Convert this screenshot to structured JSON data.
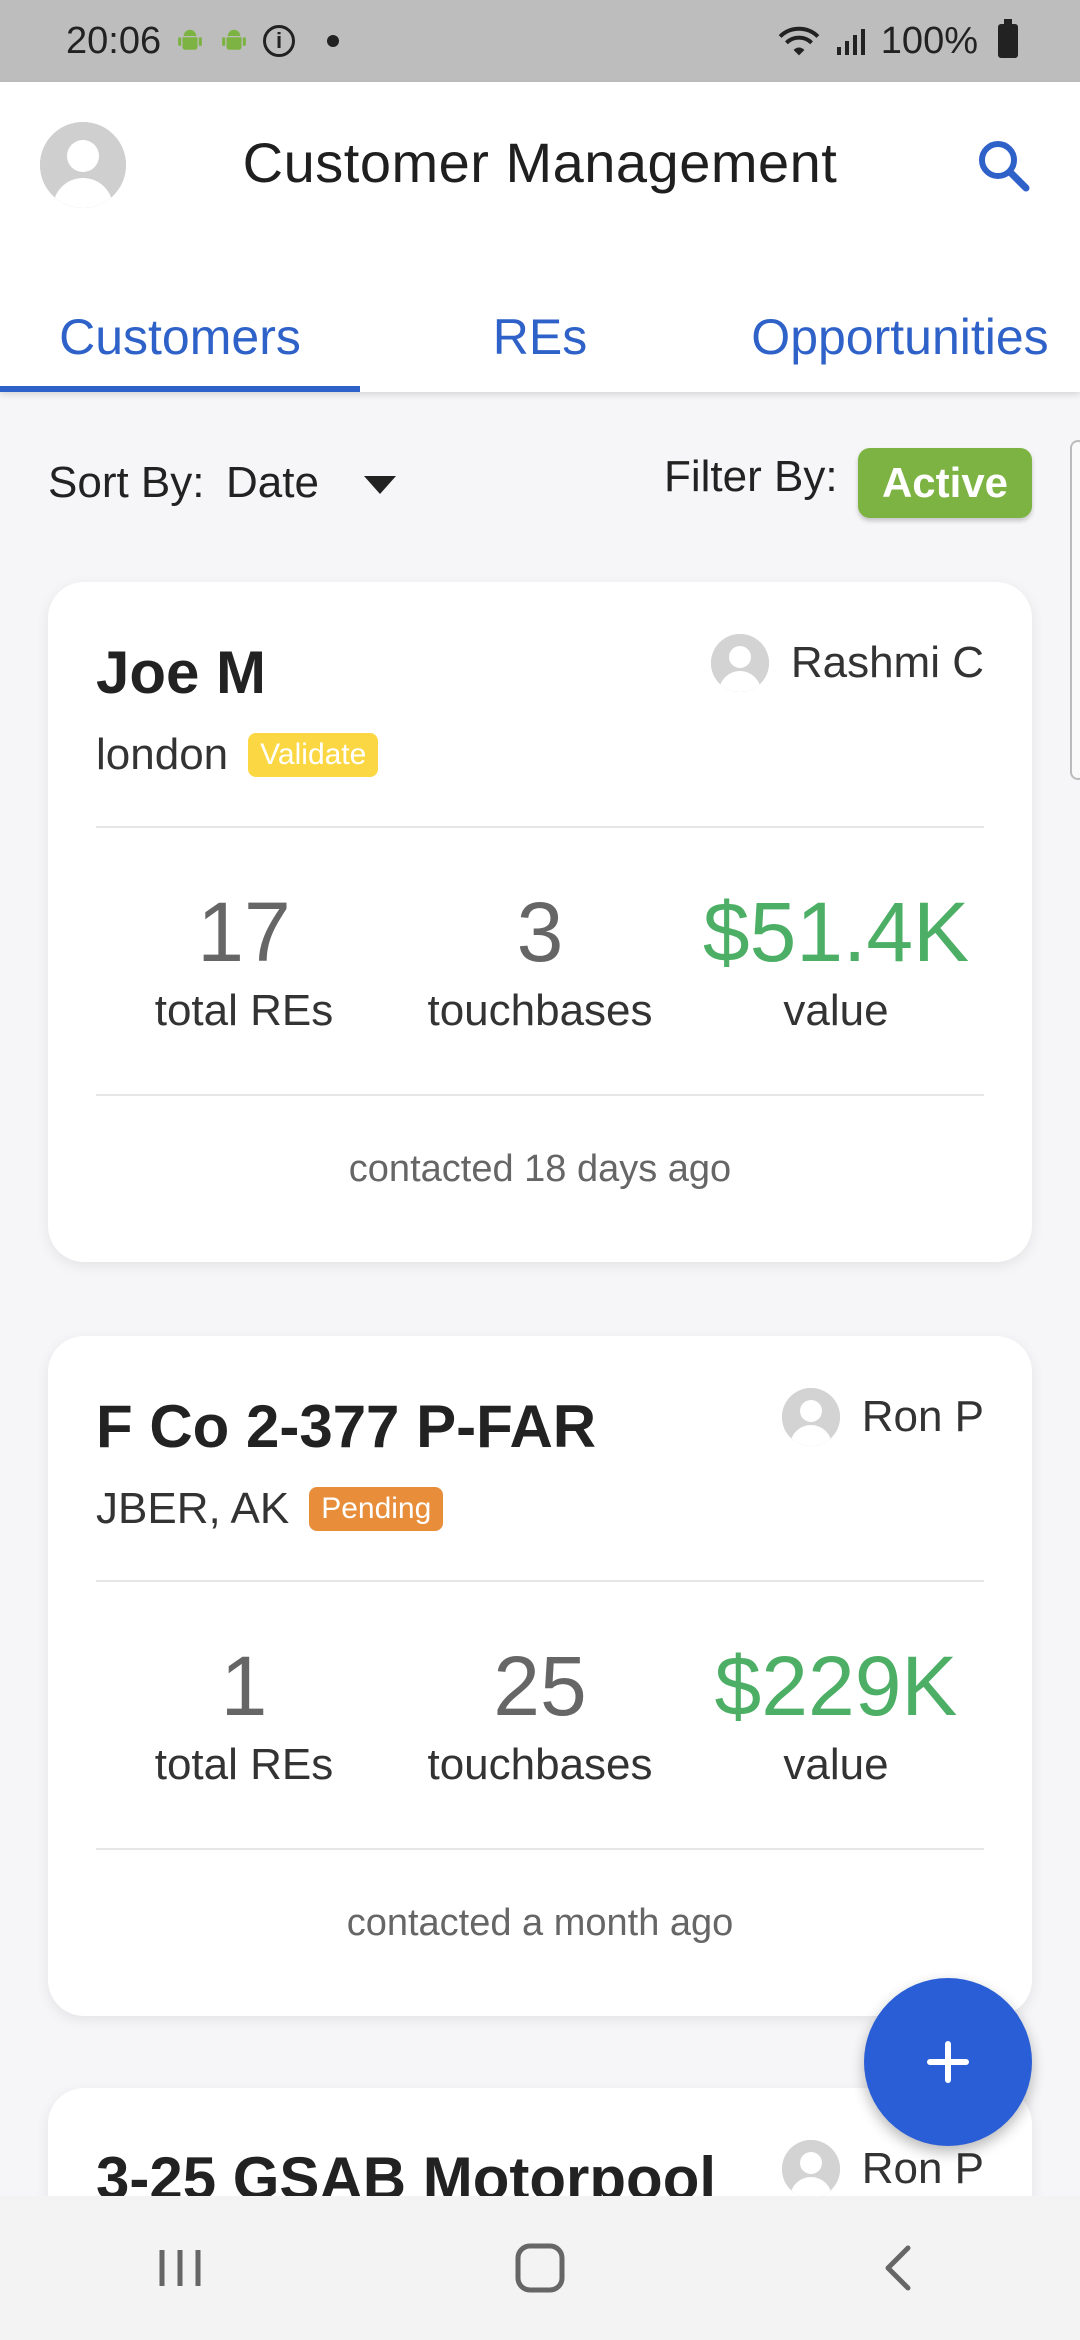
{
  "status_bar": {
    "time": "20:06",
    "battery": "100%"
  },
  "header": {
    "title": "Customer Management"
  },
  "tabs": [
    {
      "label": "Customers",
      "active": true
    },
    {
      "label": "REs",
      "active": false
    },
    {
      "label": "Opportunities",
      "active": false
    }
  ],
  "controls": {
    "sort_label": "Sort By:",
    "sort_value": "Date",
    "filter_label": "Filter By:",
    "filter_value": "Active"
  },
  "cards": [
    {
      "name": "Joe M",
      "location": "london",
      "status": "Validate",
      "assignee": "Rashmi C",
      "stats": [
        {
          "value": "17",
          "label": "total REs"
        },
        {
          "value": "3",
          "label": "touchbases"
        },
        {
          "value": "$51.4K",
          "label": "value"
        }
      ],
      "contacted": "contacted 18 days ago"
    },
    {
      "name": "F Co 2-377 P-FAR",
      "location": "JBER, AK",
      "status": "Pending",
      "assignee": "Ron P",
      "stats": [
        {
          "value": "1",
          "label": "total REs"
        },
        {
          "value": "25",
          "label": "touchbases"
        },
        {
          "value": "$229K",
          "label": "value"
        }
      ],
      "contacted": "contacted a month ago"
    },
    {
      "name": "3-25 GSAB Motorpool",
      "assignee": "Ron P"
    }
  ],
  "colors": {
    "primary": "#2f62c8",
    "fab": "#2a5ed6",
    "active_chip": "#7cb342",
    "money": "#4caf65",
    "badge_validate": "#fbd843",
    "badge_pending": "#e88d3a"
  },
  "icons": {
    "search": "search-icon",
    "add": "plus-icon",
    "avatar": "person-icon",
    "nav_recents": "recents-icon",
    "nav_home": "home-icon",
    "nav_back": "back-icon"
  }
}
